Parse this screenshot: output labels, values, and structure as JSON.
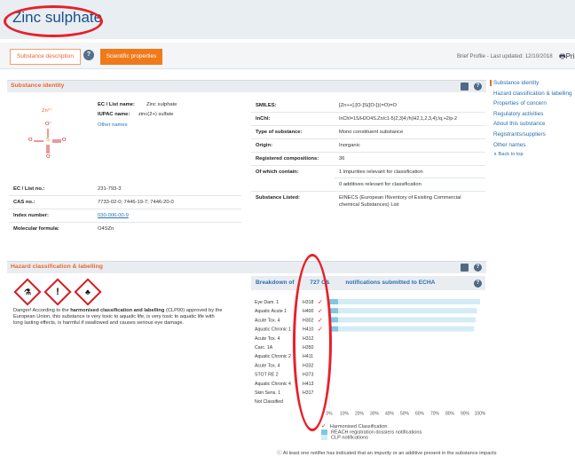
{
  "header": {
    "title": "Zinc sulphate"
  },
  "tabs": {
    "description": "Substance description",
    "help": "?",
    "scientific": "Scientific properties",
    "brief_profile": "Brief Profile - Last updated: 12/10/2018",
    "print": "Pri"
  },
  "identity": {
    "section_title": "Substance identity",
    "formula_cation": "Zn²⁺",
    "ec_list_name_label": "EC / List name:",
    "ec_list_name_value": "Zinc sulphate",
    "iupac_label": "IUPAC name:",
    "iupac_value": "zinc(2+) sulfate",
    "other_names": "Other names",
    "smiles_label": "SMILES:",
    "smiles_value": "[Zn++].[O-]S([O-])(=O)=O",
    "inchi_label": "InChI:",
    "inchi_value": "InChI=1S/H2O4S.Zn/c1-5(2,3)4;/h(H2,1,2,3,4);/q;+2/p-2",
    "type_label": "Type of substance:",
    "type_value": "Mono constituent substance",
    "origin_label": "Origin:",
    "origin_value": "Inorganic",
    "reg_comp_label": "Registered compositions:",
    "reg_comp_value": "36",
    "which_contain_label": "Of which contain:",
    "impurities_value": "1 impurities relevant for classification",
    "additives_value": "0 additives relevant for classification",
    "listed_label": "Substance Listed:",
    "listed_value_1": "EINECS (European INventory of Existing Commercial",
    "listed_value_2": "chemical Substances) List",
    "ec_no_label": "EC / List no.:",
    "ec_no_value": "231-793-3",
    "cas_label": "CAS no.:",
    "cas_value": "7733-02-0; 7446-19-7; 7446-20-0",
    "index_label": "Index number:",
    "index_value": "030-006-00-9",
    "mol_formula_label": "Molecular formula:",
    "mol_formula_value": "O4SZn",
    "structure": {
      "o_top": "O⁻",
      "o_left": "O",
      "s": "S",
      "o_right": "O",
      "o_bottom": "O"
    }
  },
  "side_nav": {
    "items": [
      "Substance identity",
      "Hazard classification & labelling",
      "Properties of concern",
      "Regulatory activities",
      "About this substance",
      "Registrants/suppliers",
      "Other names"
    ],
    "back_to_top": "∧ Back to top"
  },
  "hazard": {
    "section_title": "Hazard classification & labelling",
    "pictograms": [
      "corrosion-icon",
      "exclamation-icon",
      "environment-icon"
    ],
    "danger_line_1_a": "Danger! According to the ",
    "danger_line_1_b": "harmonised classification and labelling",
    "danger_line_1_c": " (CLP00) approved by the",
    "danger_line_2": "European Union, this substance is very toxic to aquatic life, is very toxic to aquatic life with",
    "danger_line_3": "long lasting effects, is harmful if swallowed and causes serious eye damage."
  },
  "chart_data": {
    "type": "bar",
    "title": "Breakdown of 2727 C&L notifications submitted to ECHA",
    "title_left": "Breakdown of",
    "title_mid": "727 C&",
    "title_right": "notifications submitted to ECHA",
    "categories": [
      "Eye Dam. 1",
      "Aquatic Acute 1",
      "Acute Tox. 4",
      "Aquatic Chronic 1",
      "Acute Tox. 4",
      "Carc. 1A",
      "Aquatic Chronic 2",
      "Acute Tox. 4",
      "STOT RE 2",
      "Aquatic Chronic 4",
      "Skin Sens. 1",
      "Not Classified"
    ],
    "codes": [
      "H318",
      "H400",
      "H302",
      "H410",
      "H312",
      "H350",
      "H411",
      "H332",
      "H373",
      "H413",
      "H317",
      ""
    ],
    "harmonised": [
      true,
      true,
      true,
      true,
      false,
      false,
      false,
      false,
      false,
      false,
      false,
      false
    ],
    "series": [
      {
        "name": "REACH registration dossiers notifications",
        "values": [
          6,
          6,
          6,
          6,
          0,
          0,
          0,
          0,
          0,
          0,
          0,
          0
        ],
        "color": "#7fc8e4"
      },
      {
        "name": "CLP notifications",
        "values": [
          94,
          92,
          91,
          90,
          0,
          0,
          0,
          0,
          0,
          0,
          0,
          0
        ],
        "color": "#d4ecf6"
      }
    ],
    "x_ticks": [
      "0%",
      "10%",
      "20%",
      "30%",
      "40%",
      "50%",
      "60%",
      "70%",
      "80%",
      "90%",
      "100%"
    ],
    "xlim": [
      0,
      100
    ],
    "legend": {
      "harmonised": "Harmonised Classification",
      "reach": "REACH registration dossiers notifications",
      "clp": "CLP notifications"
    },
    "footnote": "At least one notifier has indicated that an impurity or an additive present in the substance impacts"
  },
  "colors": {
    "accent": "#e8682c",
    "link": "#2a6fb0",
    "annotation": "#e8202a"
  }
}
